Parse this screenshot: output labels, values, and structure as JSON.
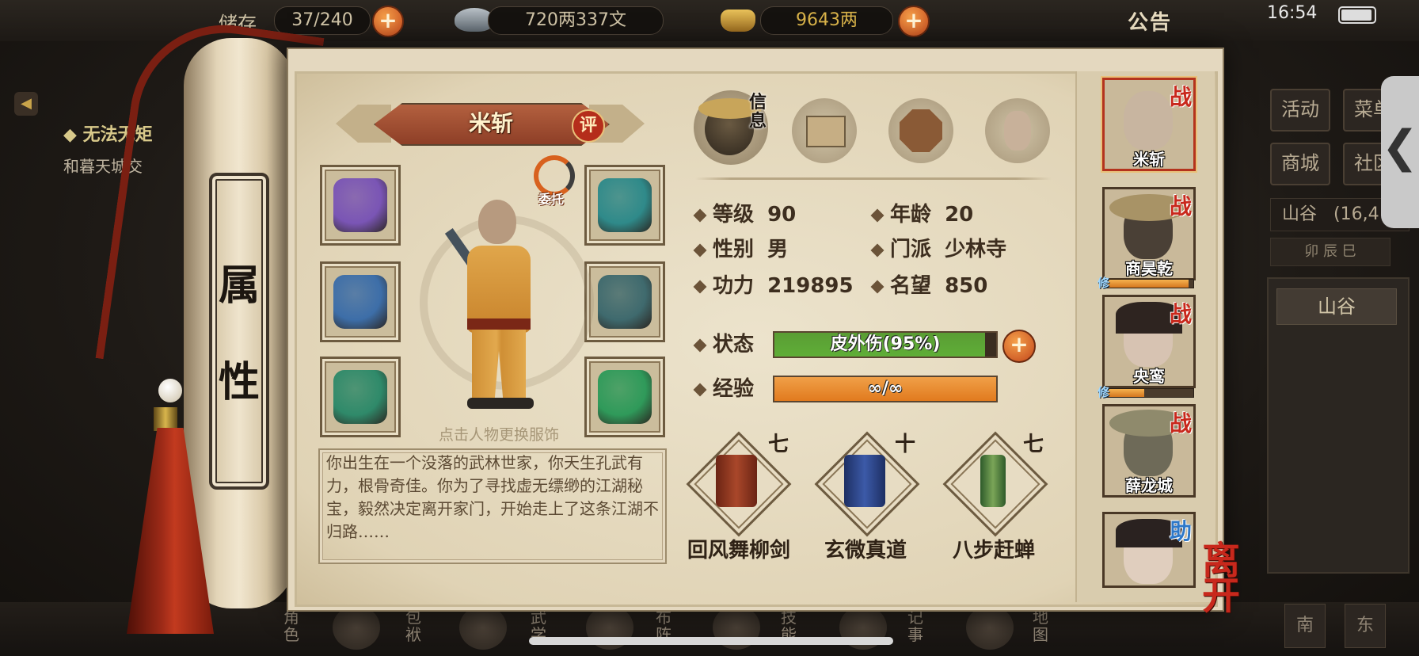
{
  "topbar": {
    "bag_label": "储存",
    "bag_count": "37/240",
    "silver": "720两337文",
    "gold": "9643两",
    "notice_label": "公告",
    "clock": "16:54"
  },
  "background": {
    "quest_title": "无法无矩",
    "quest_desc": "和暮天城交",
    "right_buttons": [
      "活动",
      "菜单",
      "商城",
      "社区"
    ],
    "location_label": "山谷",
    "location_count": "(16,4",
    "time_bar": "卯 辰 巳",
    "location_button": "山谷",
    "bottom_nav": [
      "角色",
      "包袱",
      "武学",
      "布阵",
      "技能",
      "记事",
      "地图"
    ],
    "bottom_right_buttons": [
      "南",
      "东"
    ]
  },
  "scroll": {
    "tab_chars": [
      "属",
      "性"
    ]
  },
  "character": {
    "name": "米斩",
    "rate_label": "评",
    "delegate_label": "委托",
    "change_outfit_hint": "点击人物更换服饰",
    "bio": "你出生在一个没落的武林世家，你天生孔武有力，根骨奇佳。你为了寻找虚无缥缈的江湖秘宝，毅然决定离开家门，开始走上了这条江湖不归路……"
  },
  "equipment": [
    {
      "slot": "gloves-icon",
      "color": "#7a55b5"
    },
    {
      "slot": "helmet-icon",
      "color": "#2f8a8a"
    },
    {
      "slot": "sword-icon",
      "color": "#3d6ea8"
    },
    {
      "slot": "armor-icon",
      "color": "#3f6a6e"
    },
    {
      "slot": "ring-icon",
      "color": "#2f8a6a"
    },
    {
      "slot": "amulet-icon",
      "color": "#2f9a5a"
    }
  ],
  "tabs": {
    "info_label": "信息",
    "icons": [
      "info-portrait-icon",
      "scroll-icon",
      "bagua-icon",
      "muscle-icon"
    ]
  },
  "stats": {
    "level_label": "等级",
    "level": "90",
    "age_label": "年龄",
    "age": "20",
    "gender_label": "性别",
    "gender": "男",
    "sect_label": "门派",
    "sect": "少林寺",
    "power_label": "功力",
    "power": "219895",
    "fame_label": "名望",
    "fame": "850",
    "status_label": "状态",
    "status_value": "皮外伤(95%)",
    "status_fraction": 0.95,
    "exp_label": "经验",
    "exp_value": "∞/∞",
    "exp_fraction": 1.0
  },
  "skills": [
    {
      "name": "回风舞柳剑",
      "level": "七",
      "icon": "red-book-icon"
    },
    {
      "name": "玄微真道",
      "level": "十",
      "icon": "blue-book-icon"
    },
    {
      "name": "八步赶蝉",
      "level": "七",
      "icon": "green-scroll-icon"
    }
  ],
  "roster": [
    {
      "name": "米斩",
      "badge": "战",
      "selected": true,
      "xp": null
    },
    {
      "name": "商昊乾",
      "badge": "战",
      "selected": false,
      "xp": 0.95,
      "xp_tag": "修"
    },
    {
      "name": "央鸾",
      "badge": "战",
      "selected": false,
      "xp": 0.45,
      "xp_tag": "修"
    },
    {
      "name": "薛龙城",
      "badge": "战",
      "selected": false,
      "xp": null
    },
    {
      "name": "",
      "badge": "助",
      "selected": false,
      "xp": null
    }
  ],
  "leave_label": "离开",
  "colors": {
    "status_fill": "#5fae37",
    "exp_fill": "#e17a1e",
    "battle_badge": "#c8281c",
    "assist_badge": "#2e78c8"
  }
}
